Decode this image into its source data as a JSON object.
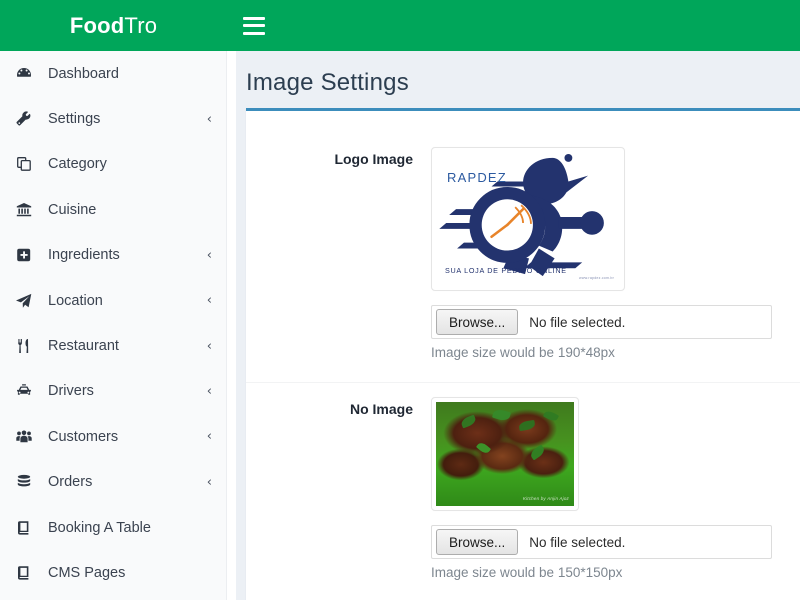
{
  "header": {
    "brand_bold": "Food",
    "brand_light": "Tro",
    "menu_toggle_label": "Toggle navigation"
  },
  "sidebar": {
    "items": [
      {
        "label": "Dashboard",
        "icon": "dashboard-icon",
        "arrow": ""
      },
      {
        "label": "Settings",
        "icon": "wrench-icon",
        "arrow": "‹"
      },
      {
        "label": "Category",
        "icon": "copy-icon",
        "arrow": ""
      },
      {
        "label": "Cuisine",
        "icon": "bank-icon",
        "arrow": ""
      },
      {
        "label": "Ingredients",
        "icon": "plus-square-icon",
        "arrow": "‹"
      },
      {
        "label": "Location",
        "icon": "paper-plane-icon",
        "arrow": "‹"
      },
      {
        "label": "Restaurant",
        "icon": "cutlery-icon",
        "arrow": "‹"
      },
      {
        "label": "Drivers",
        "icon": "taxi-icon",
        "arrow": "‹"
      },
      {
        "label": "Customers",
        "icon": "users-icon",
        "arrow": "‹"
      },
      {
        "label": "Orders",
        "icon": "database-icon",
        "arrow": "‹"
      },
      {
        "label": "Booking A Table",
        "icon": "book-icon",
        "arrow": ""
      },
      {
        "label": "CMS Pages",
        "icon": "book-icon",
        "arrow": ""
      }
    ]
  },
  "main": {
    "page_title": "Image Settings",
    "rows": [
      {
        "label": "Logo Image",
        "preview_kind": "logo",
        "logo": {
          "brand_text": "RAPDEZ",
          "tagline": "SUA LOJA DE PEDIDO ONLINE",
          "watermark": "www.rapdez.com.br"
        },
        "browse_label": "Browse...",
        "file_status": "No file selected.",
        "help_text": "Image size would be 190*48px"
      },
      {
        "label": "No Image",
        "preview_kind": "photo",
        "photo": {
          "watermark": "Kitchen by Anjin Ajoz"
        },
        "browse_label": "Browse...",
        "file_status": "No file selected.",
        "help_text": "Image size would be 150*150px"
      }
    ]
  },
  "colors": {
    "brand_green": "#00a65a",
    "panel_accent_blue": "#3c8dbc",
    "content_bg": "#ecf0f5",
    "sidebar_bg": "#f9fafb",
    "logo_navy": "#23336e"
  }
}
